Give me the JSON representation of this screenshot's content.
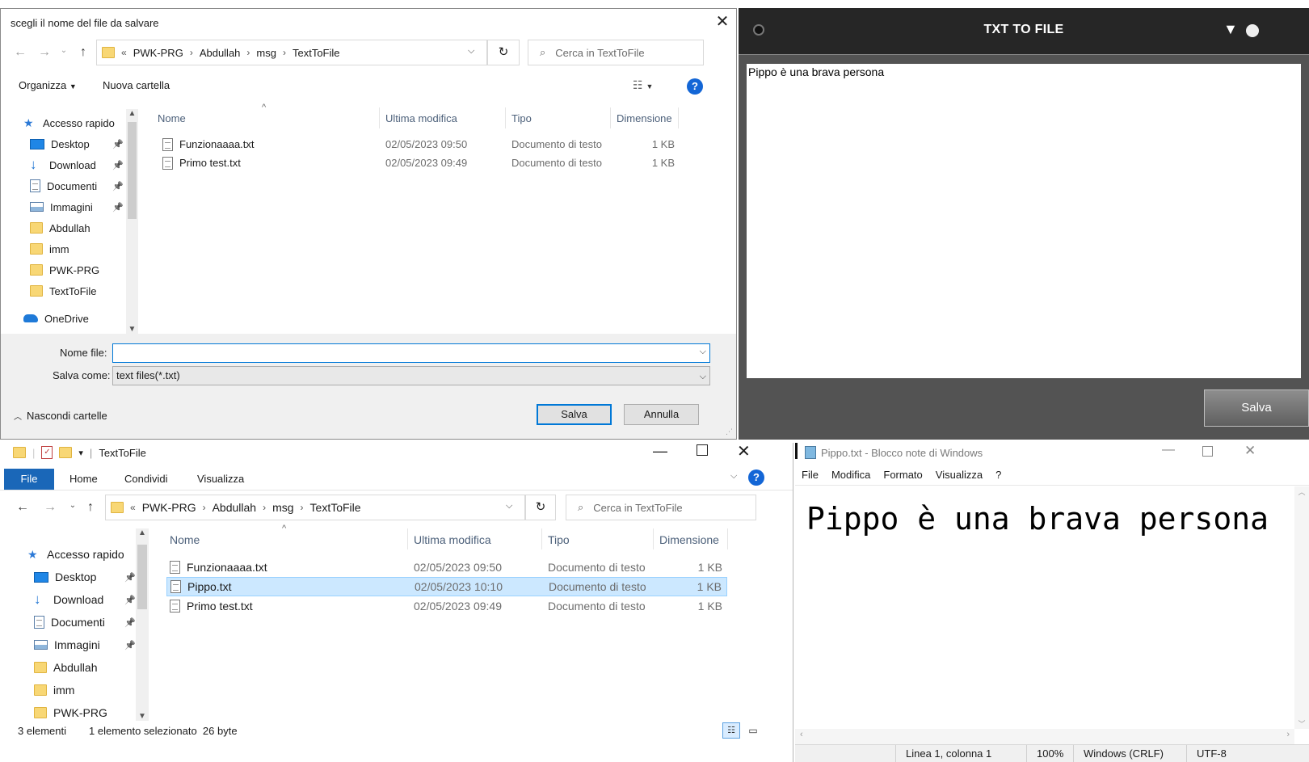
{
  "save_dialog": {
    "title": "scegli il nome del file da salvare",
    "close": "✕",
    "breadcrumb": {
      "overflow": "«",
      "parts": [
        "PWK-PRG",
        "Abdullah",
        "msg",
        "TextToFile"
      ]
    },
    "search_placeholder": "Cerca in TextToFile",
    "toolbar": {
      "organize": "Organizza",
      "new_folder": "Nuova cartella",
      "help": "?"
    },
    "nav": [
      {
        "label": "Accesso rapido",
        "icon": "star-icon",
        "pinned": false
      },
      {
        "label": "Desktop",
        "icon": "desktop-icon",
        "pinned": true
      },
      {
        "label": "Download",
        "icon": "download-icon",
        "pinned": true
      },
      {
        "label": "Documenti",
        "icon": "documents-icon",
        "pinned": true
      },
      {
        "label": "Immagini",
        "icon": "images-icon",
        "pinned": true
      },
      {
        "label": "Abdullah",
        "icon": "folder-icon",
        "pinned": false
      },
      {
        "label": "imm",
        "icon": "folder-icon",
        "pinned": false
      },
      {
        "label": "PWK-PRG",
        "icon": "folder-icon",
        "pinned": false
      },
      {
        "label": "TextToFile",
        "icon": "folder-icon",
        "pinned": false
      },
      {
        "label": "OneDrive",
        "icon": "cloud-icon",
        "pinned": false
      }
    ],
    "columns": [
      "Nome",
      "Ultima modifica",
      "Tipo",
      "Dimensione"
    ],
    "files": [
      {
        "name": "Funzionaaaa.txt",
        "modified": "02/05/2023 09:50",
        "type": "Documento di testo",
        "size": "1 KB"
      },
      {
        "name": "Primo test.txt",
        "modified": "02/05/2023 09:49",
        "type": "Documento di testo",
        "size": "1 KB"
      }
    ],
    "filename_label": "Nome file:",
    "filename_value": "",
    "saveas_label": "Salva come:",
    "saveas_value": "text files(*.txt)",
    "hide_folders": "Nascondi cartelle",
    "save_button": "Salva",
    "cancel_button": "Annulla"
  },
  "app": {
    "title": "TXT TO FILE",
    "text": "Pippo è una brava persona",
    "save_button": "Salva"
  },
  "explorer": {
    "title": "TextToFile",
    "tabs": [
      "File",
      "Home",
      "Condividi",
      "Visualizza"
    ],
    "breadcrumb": {
      "overflow": "«",
      "parts": [
        "PWK-PRG",
        "Abdullah",
        "msg",
        "TextToFile"
      ]
    },
    "search_placeholder": "Cerca in TextToFile",
    "nav": [
      {
        "label": "Accesso rapido",
        "icon": "star-icon",
        "pinned": false
      },
      {
        "label": "Desktop",
        "icon": "desktop-icon",
        "pinned": true
      },
      {
        "label": "Download",
        "icon": "download-icon",
        "pinned": true
      },
      {
        "label": "Documenti",
        "icon": "documents-icon",
        "pinned": true
      },
      {
        "label": "Immagini",
        "icon": "images-icon",
        "pinned": true
      },
      {
        "label": "Abdullah",
        "icon": "folder-icon",
        "pinned": false
      },
      {
        "label": "imm",
        "icon": "folder-icon",
        "pinned": false
      },
      {
        "label": "PWK-PRG",
        "icon": "folder-icon",
        "pinned": false
      }
    ],
    "columns": [
      "Nome",
      "Ultima modifica",
      "Tipo",
      "Dimensione"
    ],
    "files": [
      {
        "name": "Funzionaaaa.txt",
        "modified": "02/05/2023 09:50",
        "type": "Documento di testo",
        "size": "1 KB",
        "selected": false
      },
      {
        "name": "Pippo.txt",
        "modified": "02/05/2023 10:10",
        "type": "Documento di testo",
        "size": "1 KB",
        "selected": true
      },
      {
        "name": "Primo test.txt",
        "modified": "02/05/2023 09:49",
        "type": "Documento di testo",
        "size": "1 KB",
        "selected": false
      }
    ],
    "status_count": "3 elementi",
    "status_selection": "1 elemento selezionato  26 byte"
  },
  "notepad": {
    "title": "Pippo.txt - Blocco note di Windows",
    "menu": [
      "File",
      "Modifica",
      "Formato",
      "Visualizza",
      "?"
    ],
    "text": "Pippo è una brava persona",
    "status": {
      "position": "Linea 1, colonna 1",
      "zoom": "100%",
      "eol": "Windows (CRLF)",
      "encoding": "UTF-8"
    }
  }
}
